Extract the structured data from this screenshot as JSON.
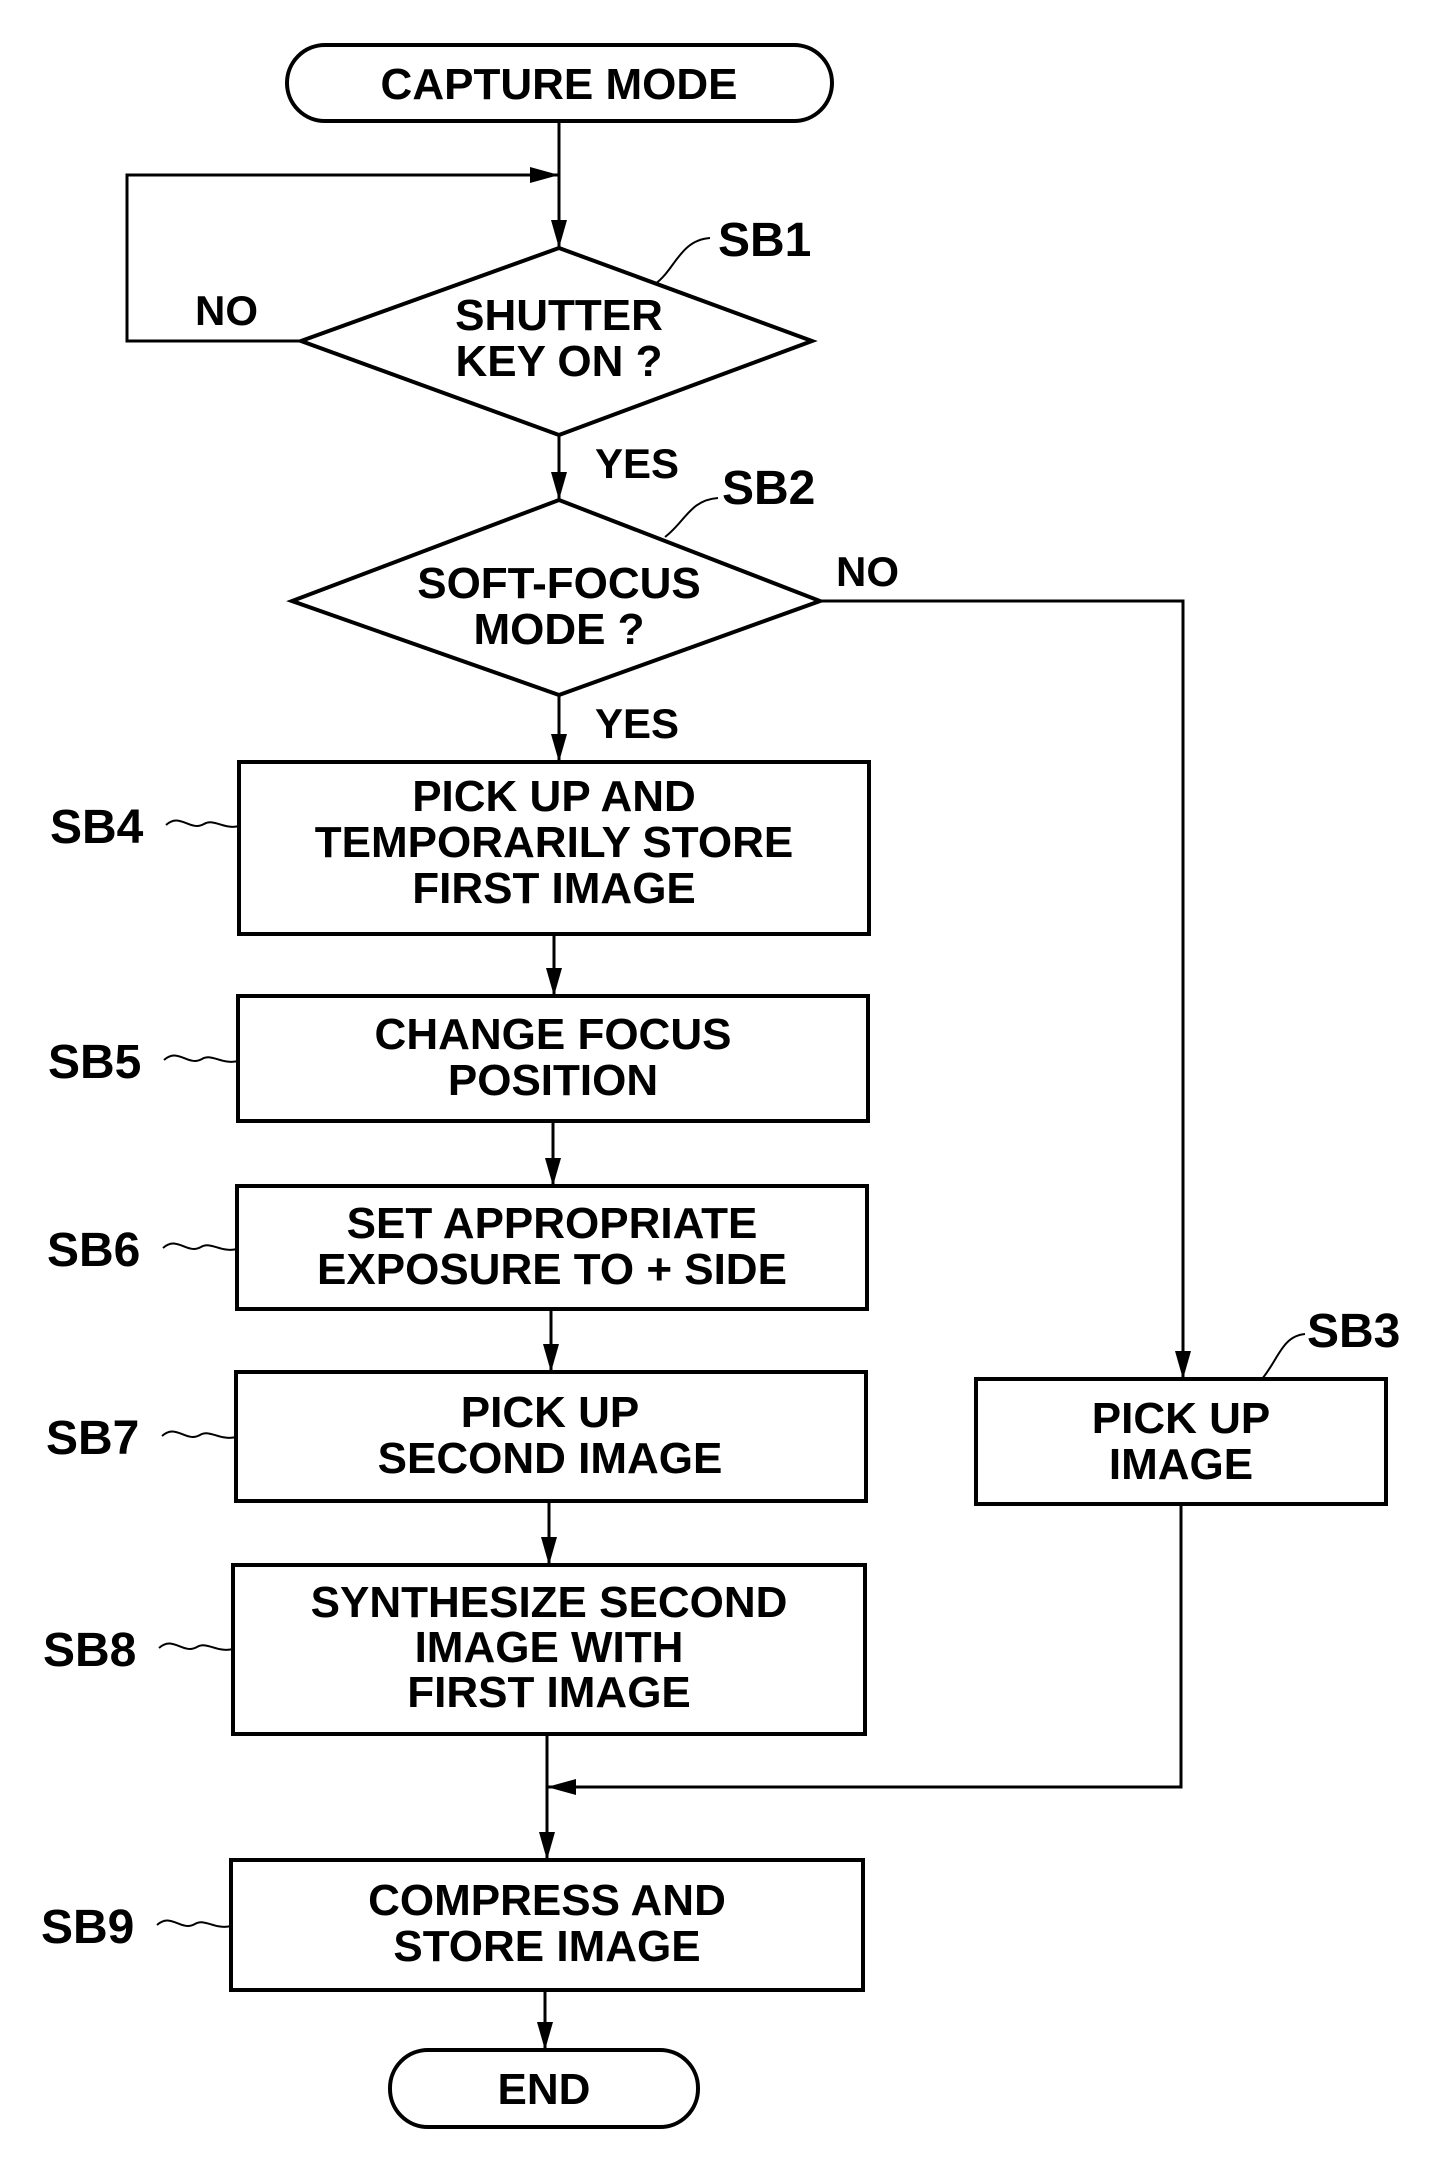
{
  "terminals": {
    "start": "CAPTURE MODE",
    "end": "END"
  },
  "steps": {
    "SB1": {
      "id": "SB1",
      "lines": [
        "SHUTTER",
        "KEY ON ?"
      ]
    },
    "SB2": {
      "id": "SB2",
      "lines": [
        "SOFT-FOCUS",
        "MODE ?"
      ]
    },
    "SB3": {
      "id": "SB3",
      "lines": [
        "PICK UP",
        "IMAGE"
      ]
    },
    "SB4": {
      "id": "SB4",
      "lines": [
        "PICK UP AND",
        "TEMPORARILY STORE",
        "FIRST IMAGE"
      ]
    },
    "SB5": {
      "id": "SB5",
      "lines": [
        "CHANGE FOCUS",
        "POSITION"
      ]
    },
    "SB6": {
      "id": "SB6",
      "lines": [
        "SET APPROPRIATE",
        "EXPOSURE TO + SIDE"
      ]
    },
    "SB7": {
      "id": "SB7",
      "lines": [
        "PICK UP",
        "SECOND IMAGE"
      ]
    },
    "SB8": {
      "id": "SB8",
      "lines": [
        "SYNTHESIZE SECOND",
        "IMAGE WITH",
        "FIRST IMAGE"
      ]
    },
    "SB9": {
      "id": "SB9",
      "lines": [
        "COMPRESS AND",
        "STORE IMAGE"
      ]
    }
  },
  "branches": {
    "sb1_no": "NO",
    "sb1_yes": "YES",
    "sb2_no": "NO",
    "sb2_yes": "YES"
  }
}
